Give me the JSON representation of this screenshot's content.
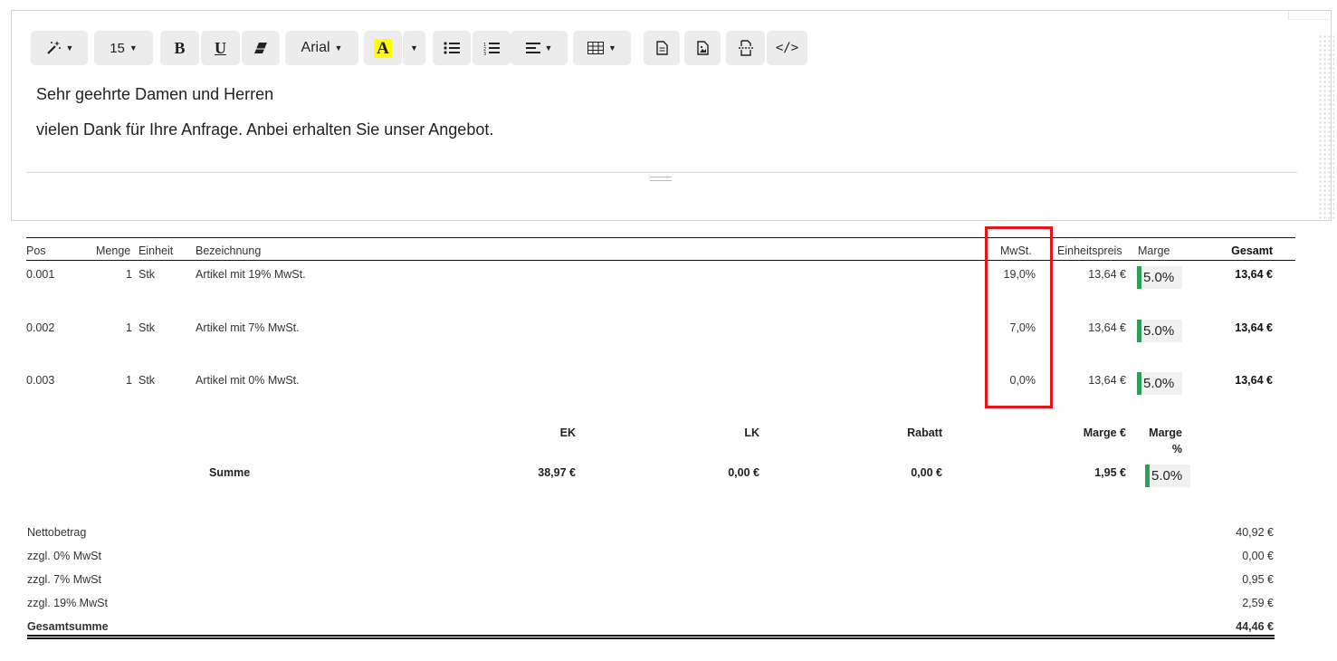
{
  "toolbar": {
    "font_size": "15",
    "font_name": "Arial",
    "bold_label": "B",
    "underline_label": "U",
    "highlight_letter": "A",
    "highlight_color": "#ffff00",
    "codeview_label": "</>"
  },
  "editor": {
    "line1": "Sehr geehrte Damen und Herren",
    "line2": "vielen Dank für Ihre Anfrage. Anbei erhalten Sie unser Angebot."
  },
  "table": {
    "headers": {
      "pos": "Pos",
      "menge": "Menge",
      "einheit": "Einheit",
      "bezeichnung": "Bezeichnung",
      "mwst": "MwSt.",
      "einheitspreis": "Einheitspreis",
      "marge": "Marge",
      "gesamt": "Gesamt"
    },
    "rows": [
      {
        "pos": "0.001",
        "menge": "1",
        "einheit": "Stk",
        "bezeichnung": "Artikel mit 19% MwSt.",
        "mwst": "19,0%",
        "einheitspreis": "13,64 €",
        "marge": "5.0%",
        "gesamt": "13,64 €"
      },
      {
        "pos": "0.002",
        "menge": "1",
        "einheit": "Stk",
        "bezeichnung": "Artikel mit 7% MwSt.",
        "mwst": "7,0%",
        "einheitspreis": "13,64 €",
        "marge": "5.0%",
        "gesamt": "13,64 €"
      },
      {
        "pos": "0.003",
        "menge": "1",
        "einheit": "Stk",
        "bezeichnung": "Artikel mit 0% MwSt.",
        "mwst": "0,0%",
        "einheitspreis": "13,64 €",
        "marge": "5.0%",
        "gesamt": "13,64 €"
      }
    ],
    "marge_color": "#2f9e57",
    "highlight_color": "#e0161a"
  },
  "summary": {
    "ek_label": "EK",
    "lk_label": "LK",
    "rabatt_label": "Rabatt",
    "marge_eur_label": "Marge €",
    "marge_pct_label_1": "Marge",
    "marge_pct_label_2": "%",
    "summe_label": "Summe",
    "ek": "38,97 €",
    "lk": "0,00 €",
    "rabatt": "0,00 €",
    "marge_eur": "1,95 €",
    "marge_pct": "5.0%"
  },
  "totals": [
    {
      "label": "Nettobetrag",
      "value": "40,92 €"
    },
    {
      "label": "zzgl. 0% MwSt",
      "value": "0,00 €"
    },
    {
      "label": "zzgl. 7% MwSt",
      "value": "0,95 €"
    },
    {
      "label": "zzgl. 19% MwSt",
      "value": "2,59 €"
    },
    {
      "label": "Gesamtsumme",
      "value": "44,46 €"
    }
  ]
}
